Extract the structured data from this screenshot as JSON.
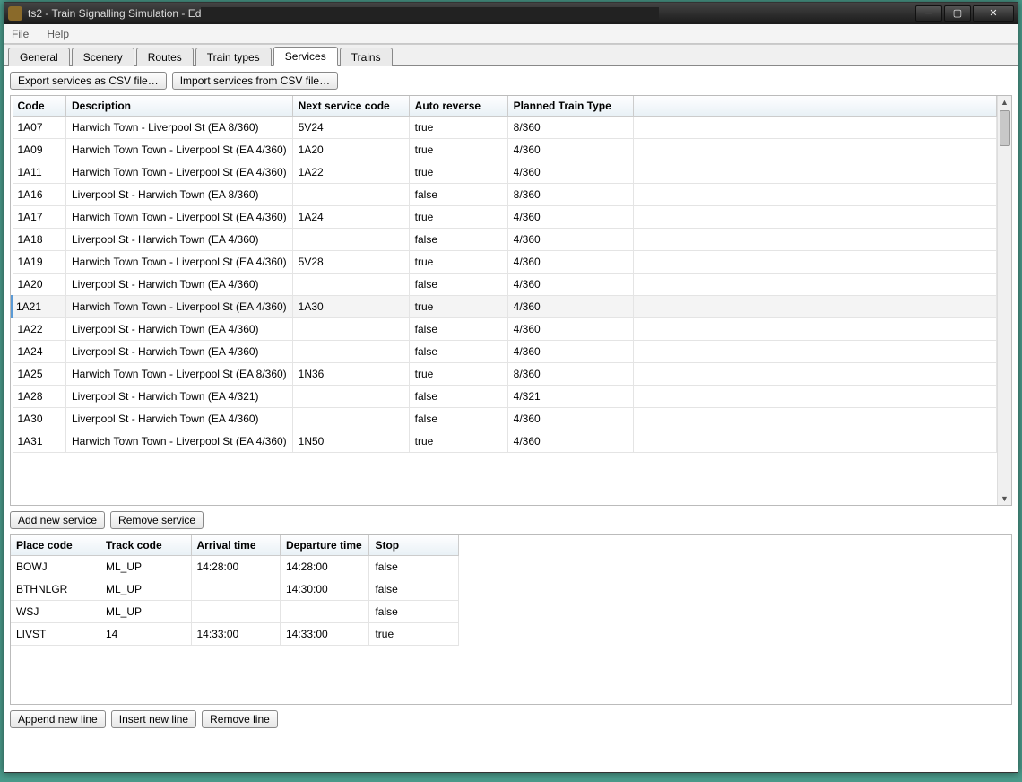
{
  "window": {
    "title": "ts2 - Train Signalling Simulation - Ed"
  },
  "menu": {
    "file": "File",
    "help": "Help"
  },
  "tabs": {
    "items": [
      "General",
      "Scenery",
      "Routes",
      "Train types",
      "Services",
      "Trains"
    ],
    "active_index": 4
  },
  "toolbar_top": {
    "export": "Export services as CSV file…",
    "import": "Import services from CSV file…"
  },
  "services_table": {
    "headers": {
      "code": "Code",
      "description": "Description",
      "next": "Next service code",
      "auto": "Auto reverse",
      "ptt": "Planned Train Type"
    },
    "selected_index": 8,
    "rows": [
      {
        "code": "1A07",
        "desc": "Harwich Town - Liverpool St (EA 8/360)",
        "next": "5V24",
        "auto": "true",
        "ptt": "8/360"
      },
      {
        "code": "1A09",
        "desc": "Harwich Town Town - Liverpool St (EA 4/360)",
        "next": "1A20",
        "auto": "true",
        "ptt": "4/360"
      },
      {
        "code": "1A11",
        "desc": "Harwich Town Town - Liverpool St (EA 4/360)",
        "next": "1A22",
        "auto": "true",
        "ptt": "4/360"
      },
      {
        "code": "1A16",
        "desc": "Liverpool St - Harwich Town (EA 8/360)",
        "next": "",
        "auto": "false",
        "ptt": "8/360"
      },
      {
        "code": "1A17",
        "desc": "Harwich Town Town - Liverpool St (EA 4/360)",
        "next": "1A24",
        "auto": "true",
        "ptt": "4/360"
      },
      {
        "code": "1A18",
        "desc": "Liverpool St - Harwich Town (EA 4/360)",
        "next": "",
        "auto": "false",
        "ptt": "4/360"
      },
      {
        "code": "1A19",
        "desc": "Harwich Town Town - Liverpool St (EA 4/360)",
        "next": "5V28",
        "auto": "true",
        "ptt": "4/360"
      },
      {
        "code": "1A20",
        "desc": "Liverpool St - Harwich Town (EA 4/360)",
        "next": "",
        "auto": "false",
        "ptt": "4/360"
      },
      {
        "code": "1A21",
        "desc": "Harwich Town Town - Liverpool St (EA 4/360)",
        "next": "1A30",
        "auto": "true",
        "ptt": "4/360"
      },
      {
        "code": "1A22",
        "desc": "Liverpool St - Harwich Town (EA 4/360)",
        "next": "",
        "auto": "false",
        "ptt": "4/360"
      },
      {
        "code": "1A24",
        "desc": "Liverpool St - Harwich Town (EA 4/360)",
        "next": "",
        "auto": "false",
        "ptt": "4/360"
      },
      {
        "code": "1A25",
        "desc": "Harwich Town Town - Liverpool St (EA 8/360)",
        "next": "1N36",
        "auto": "true",
        "ptt": "8/360"
      },
      {
        "code": "1A28",
        "desc": "Liverpool St - Harwich Town (EA 4/321)",
        "next": "",
        "auto": "false",
        "ptt": "4/321"
      },
      {
        "code": "1A30",
        "desc": "Liverpool St - Harwich Town (EA 4/360)",
        "next": "",
        "auto": "false",
        "ptt": "4/360"
      },
      {
        "code": "1A31",
        "desc": "Harwich Town Town - Liverpool St (EA 4/360)",
        "next": "1N50",
        "auto": "true",
        "ptt": "4/360"
      }
    ]
  },
  "toolbar_mid": {
    "add": "Add new service",
    "remove": "Remove service"
  },
  "details_table": {
    "headers": {
      "place": "Place code",
      "track": "Track code",
      "arr": "Arrival time",
      "dep": "Departure time",
      "stop": "Stop"
    },
    "rows": [
      {
        "place": "BOWJ",
        "track": "ML_UP",
        "arr": "14:28:00",
        "dep": "14:28:00",
        "stop": "false"
      },
      {
        "place": "BTHNLGR",
        "track": "ML_UP",
        "arr": "",
        "dep": "14:30:00",
        "stop": "false"
      },
      {
        "place": "WSJ",
        "track": "ML_UP",
        "arr": "",
        "dep": "",
        "stop": "false"
      },
      {
        "place": "LIVST",
        "track": "14",
        "arr": "14:33:00",
        "dep": "14:33:00",
        "stop": "true"
      }
    ]
  },
  "toolbar_bottom": {
    "append": "Append new line",
    "insert": "Insert new line",
    "remove": "Remove line"
  }
}
